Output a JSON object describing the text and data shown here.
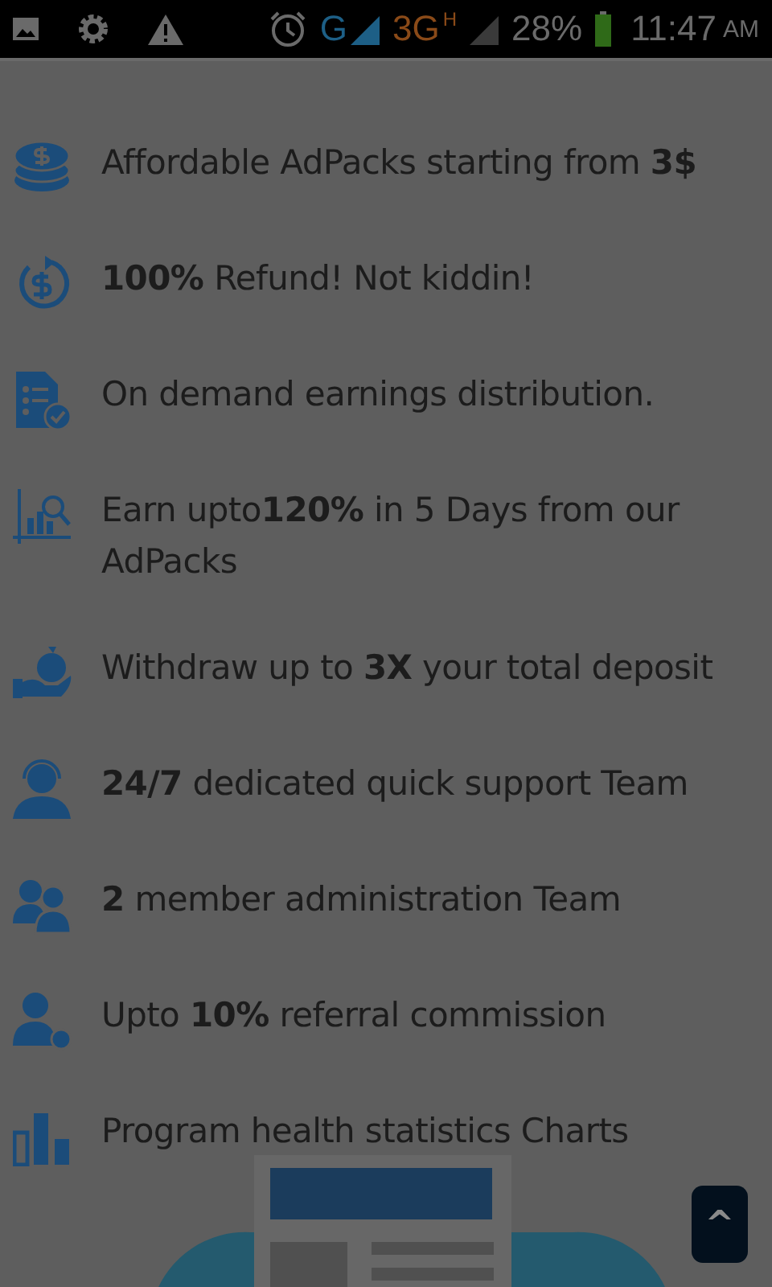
{
  "status_bar": {
    "network": "G",
    "network_2": "3G",
    "network_2_badge": "H",
    "battery": "28%",
    "time": "11:47",
    "time_suffix": "AM"
  },
  "features": [
    {
      "kind": "coins",
      "text": "Affordable AdPacks starting from **3$**"
    },
    {
      "kind": "refund",
      "text": "**100%** Refund! Not kiddin!"
    },
    {
      "kind": "checklist",
      "text": "On demand earnings distribution."
    },
    {
      "kind": "chart",
      "text": "Earn upto**120%** in 5 Days from our AdPacks"
    },
    {
      "kind": "money-hand",
      "text": "Withdraw up to **3X** your total deposit"
    },
    {
      "kind": "support",
      "text": "**24/7** dedicated quick support Team"
    },
    {
      "kind": "team",
      "text": "**2** member administration Team"
    },
    {
      "kind": "referral",
      "text": "Upto **10%** referral commission"
    },
    {
      "kind": "bars",
      "text": "Program health statistics Charts"
    }
  ],
  "scroll_top_button": {
    "label": "^"
  }
}
